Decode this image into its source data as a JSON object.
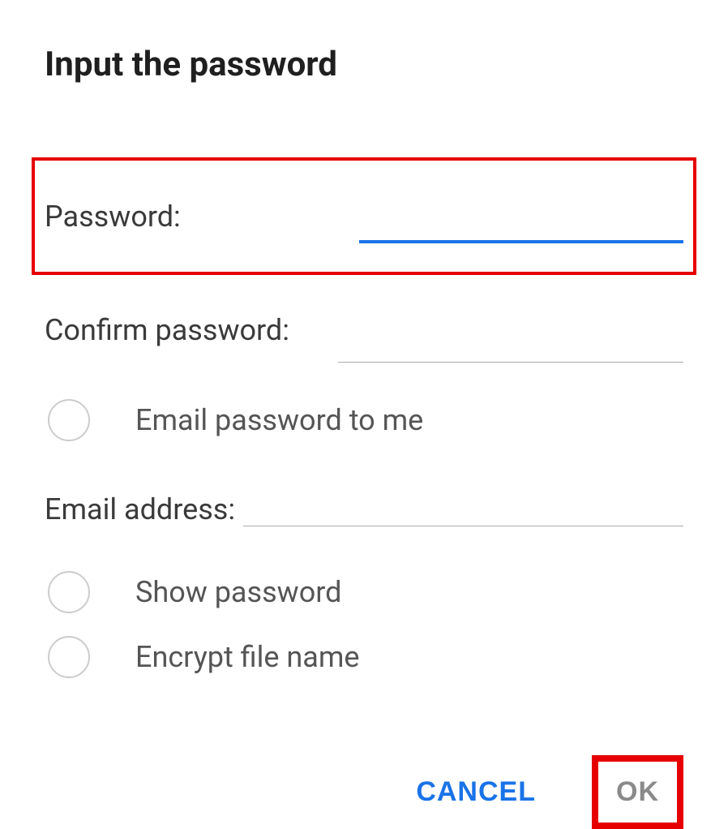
{
  "dialog": {
    "title": "Input the password",
    "password_label": "Password:",
    "confirm_label": "Confirm password:",
    "email_checkbox_label": "Email password to me",
    "email_address_label": "Email address:",
    "show_password_label": "Show password",
    "encrypt_filename_label": "Encrypt file name",
    "cancel_button": "CANCEL",
    "ok_button": "OK"
  }
}
